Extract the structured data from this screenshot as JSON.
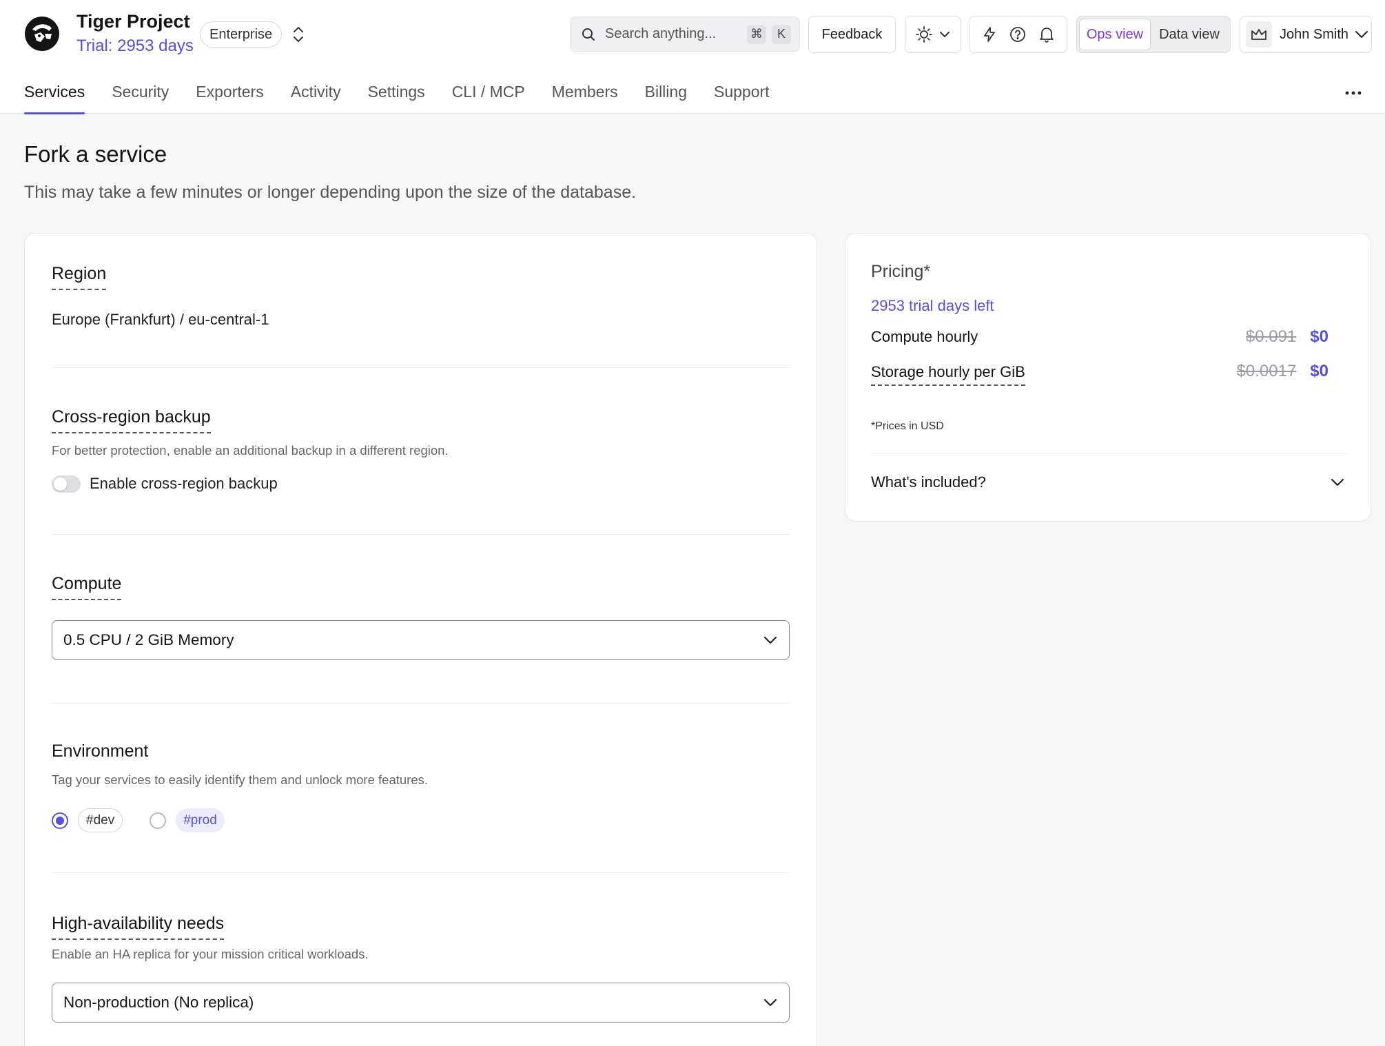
{
  "header": {
    "project_name": "Tiger Project",
    "trial_text": "Trial: 2953 days",
    "plan_badge": "Enterprise",
    "search_placeholder": "Search anything...",
    "search_shortcut": [
      "⌘",
      "K"
    ],
    "feedback_label": "Feedback",
    "views": [
      {
        "label": "Ops view",
        "active": true
      },
      {
        "label": "Data view",
        "active": false
      }
    ],
    "user_name": "John Smith",
    "accent_color": "#5551d9"
  },
  "nav": {
    "tabs": [
      {
        "label": "Services",
        "active": true
      },
      {
        "label": "Security"
      },
      {
        "label": "Exporters"
      },
      {
        "label": "Activity"
      },
      {
        "label": "Settings"
      },
      {
        "label": "CLI / MCP"
      },
      {
        "label": "Members"
      },
      {
        "label": "Billing"
      },
      {
        "label": "Support"
      }
    ]
  },
  "page": {
    "title": "Fork a service",
    "subtitle": "This may take a few minutes or longer depending upon the size of the database."
  },
  "form": {
    "region": {
      "title": "Region",
      "value": "Europe (Frankfurt) / eu-central-1"
    },
    "cross_region_backup": {
      "title": "Cross-region backup",
      "description": "For better protection, enable an additional backup in a different region.",
      "toggle_label": "Enable cross-region backup",
      "enabled": false
    },
    "compute": {
      "title": "Compute",
      "selected": "0.5 CPU / 2 GiB Memory"
    },
    "environment": {
      "title": "Environment",
      "description": "Tag your services to easily identify them and unlock more features.",
      "options": [
        {
          "label": "#dev",
          "checked": true
        },
        {
          "label": "#prod",
          "checked": false
        }
      ]
    },
    "high_availability": {
      "title": "High-availability needs",
      "description": "Enable an HA replica for your mission critical workloads.",
      "selected": "Non-production (No replica)"
    }
  },
  "pricing": {
    "title": "Pricing*",
    "trial_left": "2953 trial days left",
    "rows": [
      {
        "label": "Compute hourly",
        "old_price": "$0.091",
        "new_price": "$0"
      },
      {
        "label": "Storage hourly per GiB",
        "old_price": "$0.0017",
        "new_price": "$0"
      }
    ],
    "note": "*Prices in USD",
    "included_label": "What's included?"
  }
}
